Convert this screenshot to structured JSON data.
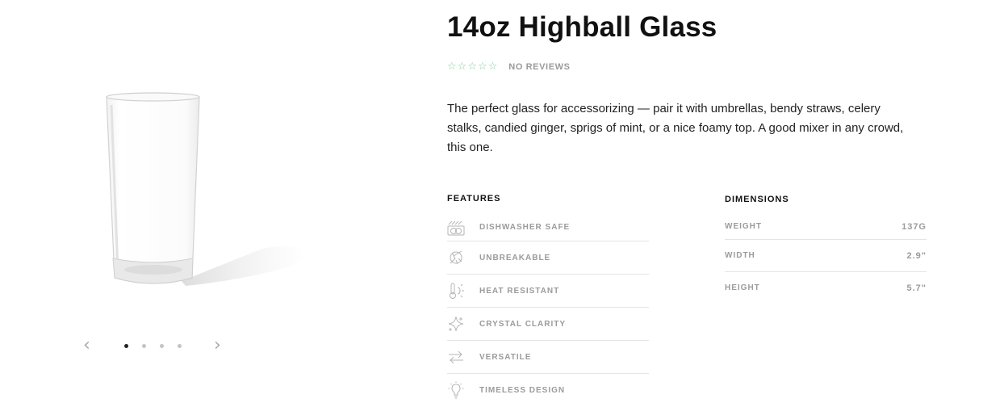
{
  "product": {
    "title": "14oz Highball Glass",
    "rating": {
      "stars_filled": 0,
      "stars_total": 5,
      "reviews_label": "NO REVIEWS"
    },
    "description": "The perfect glass for accessorizing — pair it with umbrellas, bendy straws, celery stalks, candied ginger, sprigs of mint, or a nice foamy top. A good mixer in any crowd, this one."
  },
  "gallery": {
    "image_icon": "highball-glass-image",
    "prev_icon": "chevron-left-icon",
    "next_icon": "chevron-right-icon",
    "slide_count": 4,
    "active_slide": 1
  },
  "features": {
    "heading": "FEATURES",
    "items": [
      {
        "label": "DISHWASHER SAFE",
        "icon": "dishwasher-icon"
      },
      {
        "label": "UNBREAKABLE",
        "icon": "unbreakable-icon"
      },
      {
        "label": "HEAT RESISTANT",
        "icon": "thermometer-icon"
      },
      {
        "label": "CRYSTAL CLARITY",
        "icon": "sparkle-icon"
      },
      {
        "label": "VERSATILE",
        "icon": "arrows-icon"
      },
      {
        "label": "TIMELESS DESIGN",
        "icon": "lightbulb-icon"
      }
    ]
  },
  "dimensions": {
    "heading": "DIMENSIONS",
    "items": [
      {
        "label": "WEIGHT",
        "value": "137G"
      },
      {
        "label": "WIDTH",
        "value": "2.9\""
      },
      {
        "label": "HEIGHT",
        "value": "5.7\""
      }
    ]
  },
  "colors": {
    "star": "#8fcf9b",
    "muted_text": "#9b9b9b",
    "divider": "#e4e4e4"
  }
}
